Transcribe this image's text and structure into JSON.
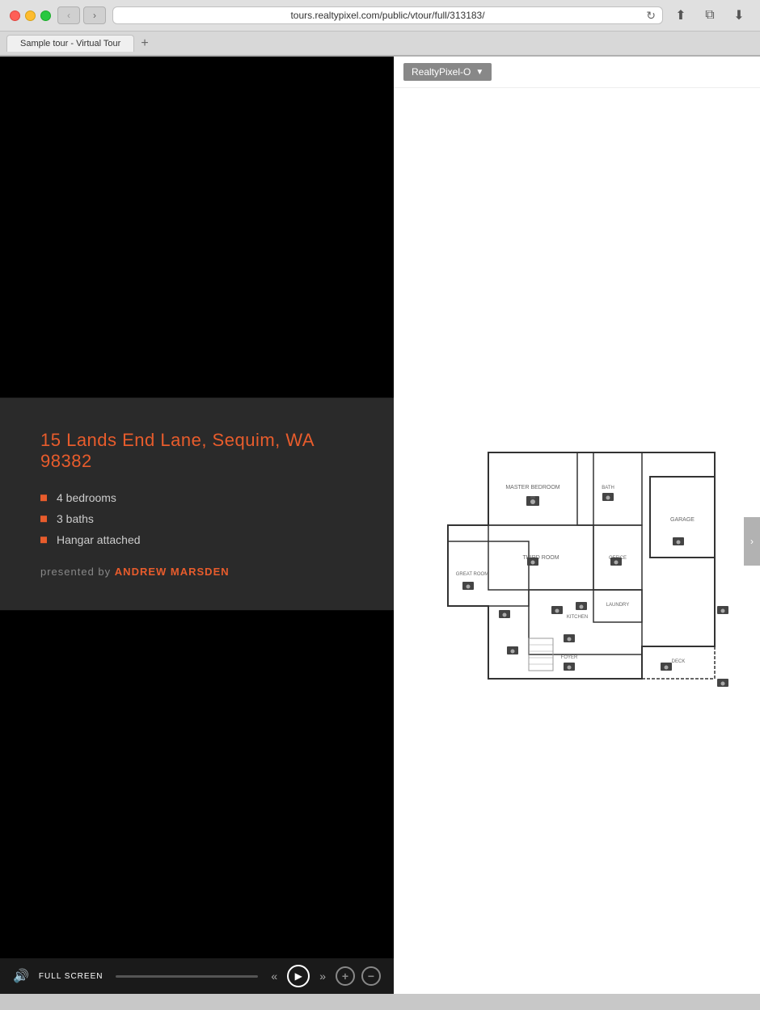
{
  "browser": {
    "url": "tours.realtypixel.com/public/vtour/full/313183/",
    "tab_label": "Sample tour - Virtual Tour",
    "tab_plus": "+",
    "back_arrow": "‹",
    "forward_arrow": "›",
    "refresh_icon": "↻",
    "share_icon": "⬆",
    "window_icon": "⧉",
    "download_icon": "⬇"
  },
  "property": {
    "address": "15 Lands End Lane, Sequim, WA 98382",
    "features": [
      "4 bedrooms",
      "3 baths",
      "Hangar attached"
    ],
    "presented_by_label": "presented by",
    "presenter_name": "ANDREW MARSDEN"
  },
  "floorplan": {
    "dropdown_label": "RealtyPixel-O",
    "dropdown_arrow": "▼"
  },
  "controls": {
    "fullscreen_label": "FULL SCREEN",
    "volume_icon": "🔊",
    "prev_icon": "«",
    "play_icon": "▶",
    "next_icon": "»",
    "zoom_in": "+",
    "zoom_out": "−",
    "right_chevron": "›"
  },
  "colors": {
    "accent": "#e85c2c",
    "dark_bg": "#1a1a1a",
    "panel_bg": "#2a2a2a"
  }
}
